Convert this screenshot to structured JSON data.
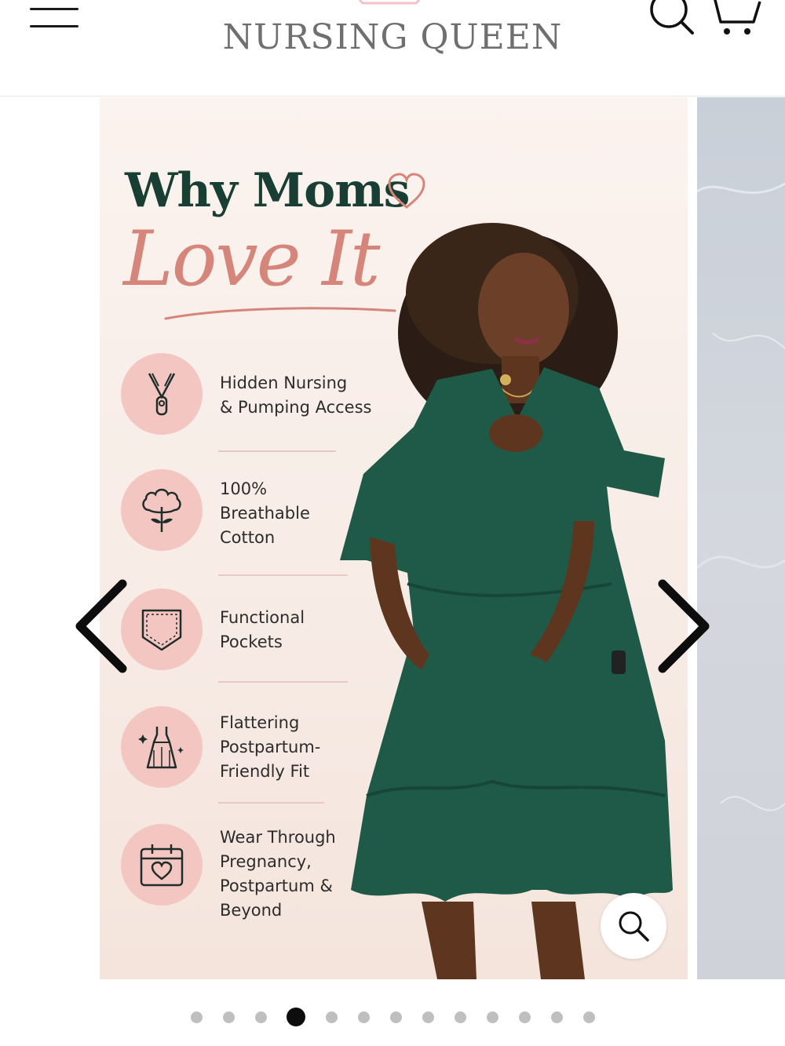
{
  "header": {
    "brand": "NURSING QUEEN",
    "menu_icon": "hamburger-menu-icon",
    "search_icon": "search-icon",
    "cart_icon": "cart-icon"
  },
  "slide": {
    "headline_line1": "Why Moms",
    "headline_line2": "Love It",
    "features": [
      {
        "icon": "zipper-icon",
        "text": "Hidden Nursing\n& Pumping Access"
      },
      {
        "icon": "cotton-icon",
        "text": "100%\nBreathable\nCotton"
      },
      {
        "icon": "pocket-icon",
        "text": "Functional\nPockets"
      },
      {
        "icon": "dress-icon",
        "text": "Flattering\nPostpartum-\nFriendly Fit"
      },
      {
        "icon": "calendar-heart-icon",
        "text": "Wear Through\nPregnancy,\nPostpartum &\nBeyond"
      }
    ]
  },
  "carousel": {
    "prev_icon": "chevron-left-icon",
    "next_icon": "chevron-right-icon",
    "zoom_icon": "zoom-icon",
    "slide_count": 13,
    "active_index": 3
  },
  "colors": {
    "headline_green": "#193e34",
    "headline_pink": "#d5857a",
    "icon_circle": "#f4c6c2",
    "dress_green": "#1f5a48",
    "dot_active": "#0d0d0d",
    "dot_inactive": "#bfbfbf"
  }
}
